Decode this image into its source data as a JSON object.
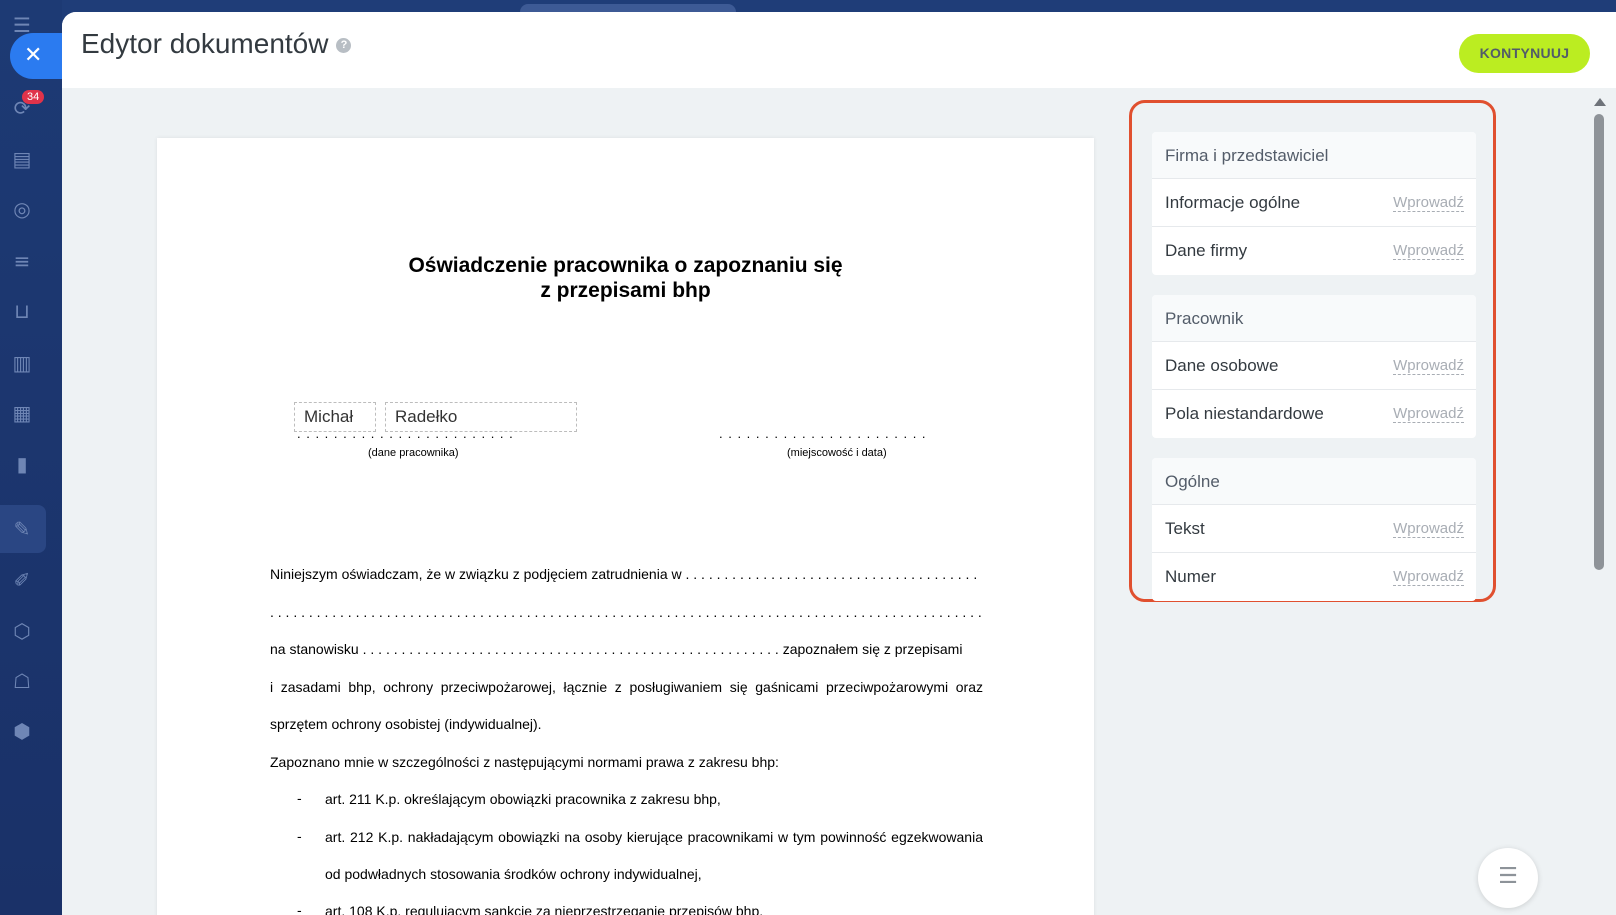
{
  "rail": {
    "badge_count": "34",
    "icons": [
      "menu-icon",
      "close-icon",
      "workflow-icon",
      "contact-card-icon",
      "target-icon",
      "filter-icon",
      "cart-icon",
      "store-icon",
      "calendar-icon",
      "chart-icon",
      "document-edit-icon",
      "pen-icon",
      "settings-icon",
      "robot-icon",
      "box-icon"
    ]
  },
  "header": {
    "title": "Edytor dokumentów",
    "continue_label": "KONTYNUUJ"
  },
  "document": {
    "title_line1": "Oświadczenie pracownika o zapoznaniu się",
    "title_line2": "z przepisami bhp",
    "first_name": "Michał",
    "last_name": "Radełko",
    "caption_employee": "(dane pracownika)",
    "caption_place_date": "(miejscowość i data)",
    "dots_short": ". . . . . . . . . . . . . . . . . . . . . . . . . . . . . .",
    "dots_medium": ". . . . . . . . . . . . . . . . . . . . . . . . . . . .",
    "para1_text": "Niniejszym oświadczam, że w związku z podjęciem zatrudnienia w",
    "para1_dots": ". . . . . . . . . . . . . . . . . . . . . . . . . . . . . . . . . . . . . .",
    "para2_dots": ". . . . . . . . . . . . . . . . . . . . . . . . . . . . . . . . . . . . . . . . . . . . . . . . . . . . . . . . . . . . . . . . . . . . . . . . . . . . . . . . . . . . . . . . . . . . . . . . . . . . . . . .",
    "para3_start": "na stanowisku",
    "para3_dots": ". . . . . . . . . . . . . . . . . . . . . . . . . . . . . . . . . . . . . . . . . . . . . . . . . . . . . .",
    "para3_end": "zapoznałem się z przepisami",
    "para4": "i zasadami bhp, ochrony przeciwpożarowej, łącznie z posługiwaniem się gaśnicami przeciwpożarowymi oraz",
    "para5": "sprzętem ochrony osobistej (indywidualnej).",
    "para6": "Zapoznano mnie w szczególności z następującymi normami prawa z zakresu bhp:",
    "bullet_mark": "-",
    "bullet1": "art. 211 K.p. określającym obowiązki pracownika z zakresu bhp,",
    "bullet2_line1": "art. 212 K.p. nakładającym obowiązki na osoby kierujące pracownikami w tym powinność egzekwowania",
    "bullet2_line2": "od podwładnych stosowania środków ochrony indywidualnej,",
    "bullet3": "art. 108 K.p. regulującym sankcje za nieprzestrzeganie przepisów bhp,"
  },
  "sidebar": {
    "action_label": "Wprowadź",
    "groups": [
      {
        "title": "Firma i przedstawiciel",
        "items": [
          "Informacje ogólne",
          "Dane firmy"
        ]
      },
      {
        "title": "Pracownik",
        "items": [
          "Dane osobowe",
          "Pola niestandardowe"
        ]
      },
      {
        "title": "Ogólne",
        "items": [
          "Tekst",
          "Numer"
        ]
      }
    ]
  },
  "colors": {
    "accent_green": "#bbed21",
    "highlight_frame": "#e0502f",
    "close_blue": "#2b7bf0"
  }
}
